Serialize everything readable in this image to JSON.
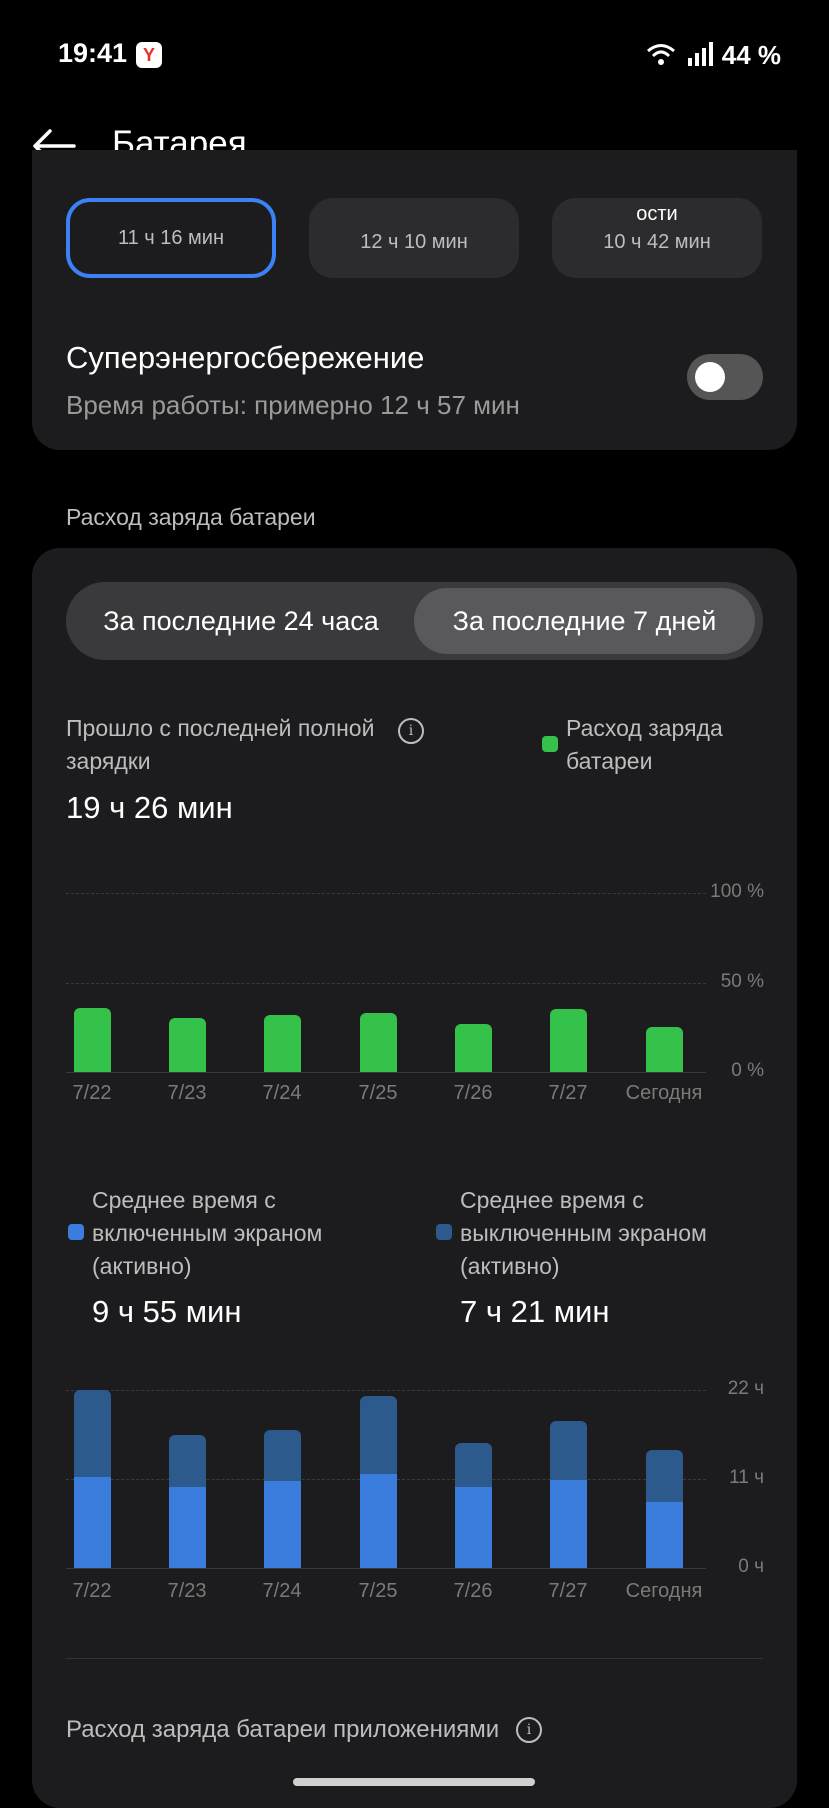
{
  "status_bar": {
    "time": "19:41",
    "battery": "44 %"
  },
  "header": {
    "title": "Батарея"
  },
  "modes": [
    {
      "name": "",
      "value": "11 ч 16 мин",
      "selected": true
    },
    {
      "name": "",
      "value": "12 ч 10 мин",
      "selected": false
    },
    {
      "name": "ости",
      "value": "10 ч 42 мин",
      "selected": false
    }
  ],
  "super_saving": {
    "title": "Суперэнергосбережение",
    "subtitle": "Время работы: примерно 12 ч 57 мин",
    "enabled": false
  },
  "usage": {
    "section_label": "Расход заряда батареи",
    "tabs": [
      "За последние 24 часа",
      "За последние 7 дней"
    ],
    "selected_tab": 1,
    "since_label": "Прошло с последней полной зарядки",
    "since_value": "19 ч 26 мин",
    "legend_label": "Расход заряда батареи",
    "screen_on_label": "Среднее время с включенным экраном (активно)",
    "screen_on_value": "9 ч 55 мин",
    "screen_off_label": "Среднее время с выключенным экраном (активно)",
    "screen_off_value": "7 ч 21 мин"
  },
  "apps_label": "Расход заряда батареи приложениями",
  "chart_data": [
    {
      "type": "bar",
      "title": "",
      "categories": [
        "7/22",
        "7/23",
        "7/24",
        "7/25",
        "7/26",
        "7/27",
        "Сегодня"
      ],
      "series": [
        {
          "name": "Расход заряда батареи",
          "values": [
            36,
            30,
            32,
            33,
            27,
            35,
            25
          ]
        }
      ],
      "y_ticks": [
        "100 %",
        "50 %",
        "0 %"
      ],
      "ylim": [
        0,
        100
      ],
      "colors": {
        "bar": "#35c24a"
      }
    },
    {
      "type": "bar",
      "stacked": true,
      "title": "",
      "categories": [
        "7/22",
        "7/23",
        "7/24",
        "7/25",
        "7/26",
        "7/27",
        "Сегодня"
      ],
      "series": [
        {
          "name": "Среднее время с включенным экраном (активно)",
          "values": [
            11.2,
            10.0,
            10.7,
            11.6,
            10.0,
            10.9,
            8.1
          ]
        },
        {
          "name": "Среднее время с выключенным экраном (активно)",
          "values": [
            10.8,
            6.4,
            6.3,
            9.7,
            5.4,
            7.3,
            6.5
          ]
        }
      ],
      "y_ticks": [
        "22 ч",
        "11 ч",
        "0 ч"
      ],
      "ylim": [
        0,
        22
      ],
      "colors": {
        "on": "#3b7ddd",
        "off": "#2c5a8c"
      }
    }
  ]
}
